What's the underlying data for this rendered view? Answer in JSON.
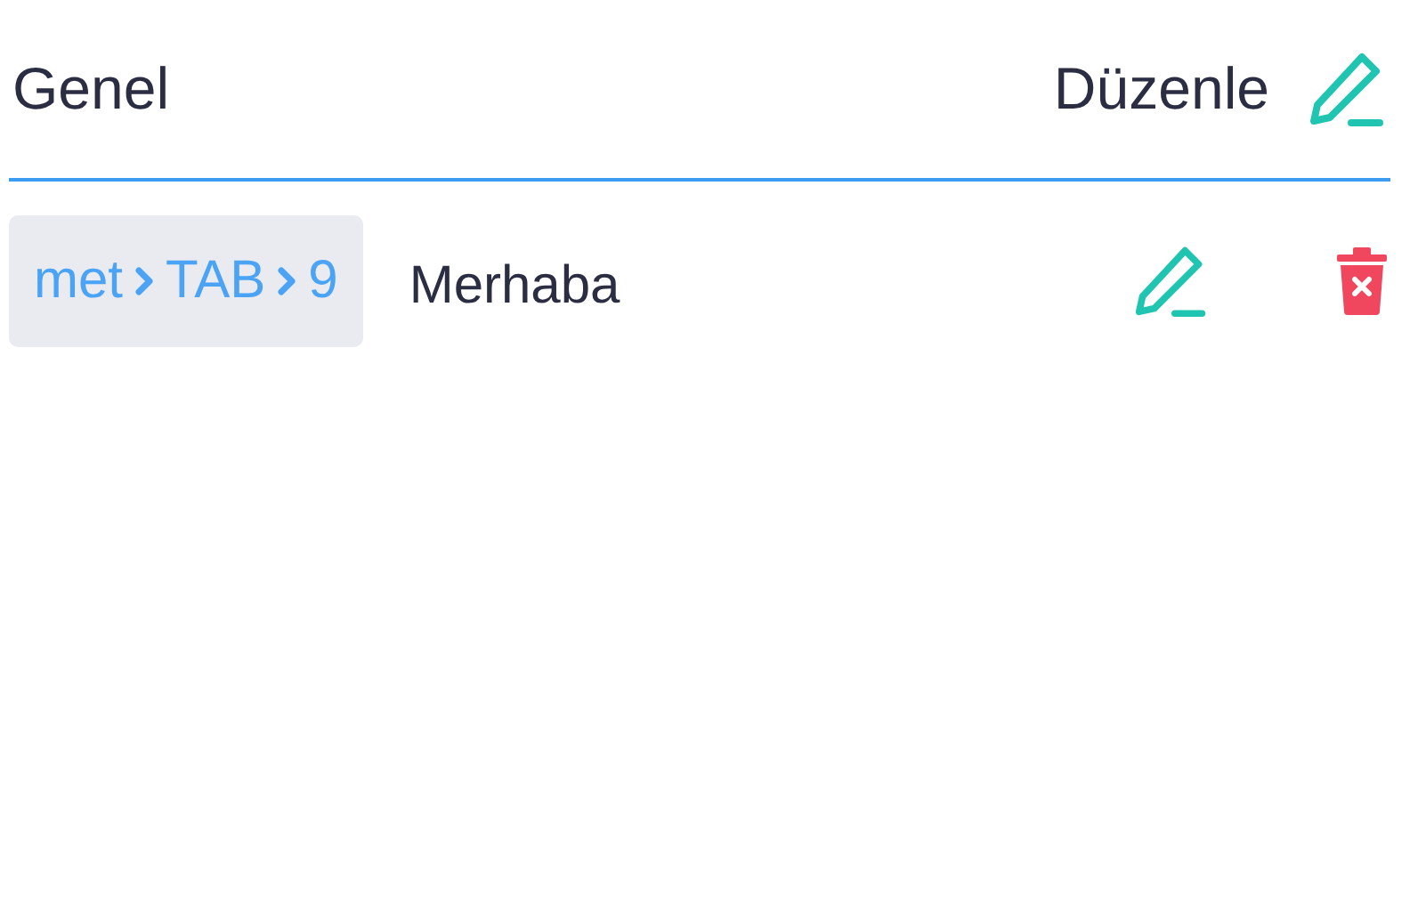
{
  "header": {
    "title": "Genel",
    "edit_label": "Düzenle"
  },
  "entries": [
    {
      "shortcut": [
        "met",
        "TAB",
        "9"
      ],
      "text": "Merhaba"
    }
  ]
}
